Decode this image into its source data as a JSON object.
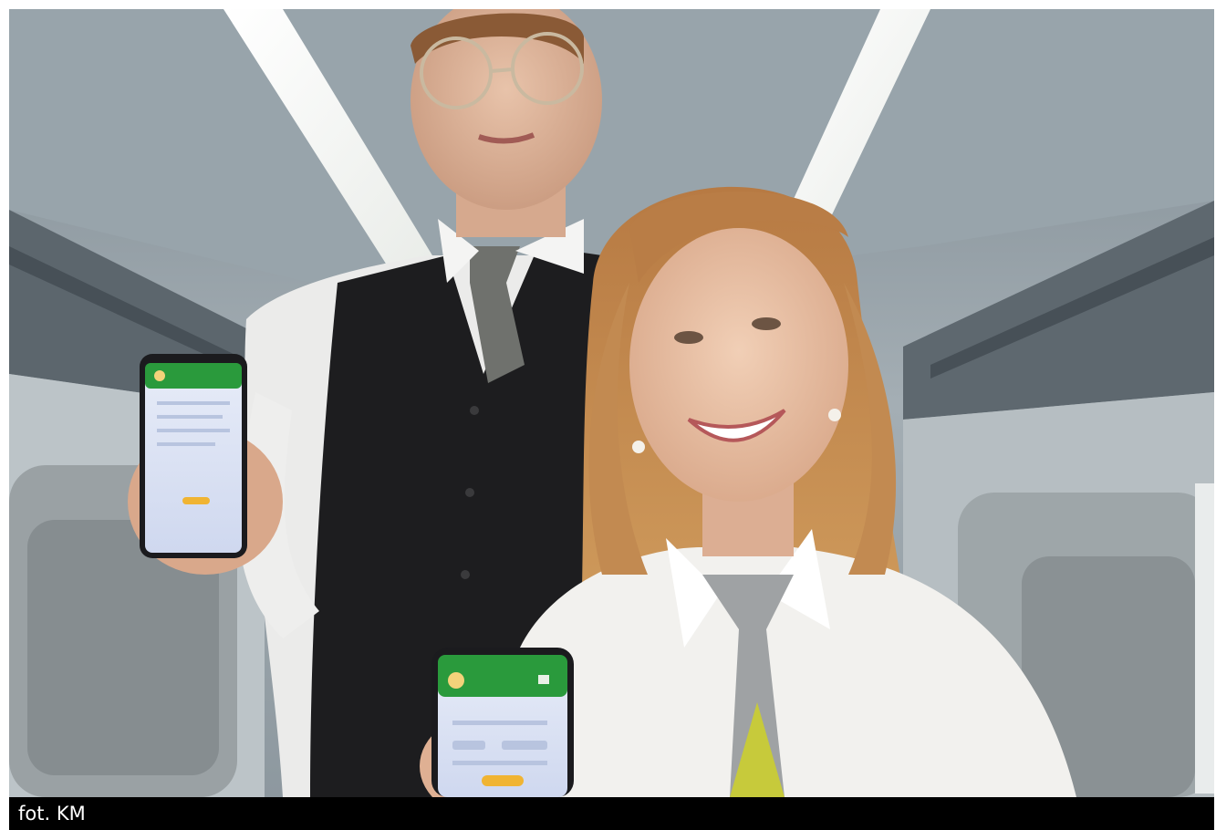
{
  "caption": "fot. KM",
  "colors": {
    "app_green": "#2a9a3c",
    "screen_blue": "#dfe8f7",
    "app_button": "#f0b432",
    "vest": "#1d1d1f",
    "shirt": "#ececec",
    "hair": "#c58a4c",
    "ceiling": "#8e9aa2",
    "light": "#fbfbf6"
  },
  "icons": [
    "company-logo-icon",
    "menu-icon"
  ]
}
